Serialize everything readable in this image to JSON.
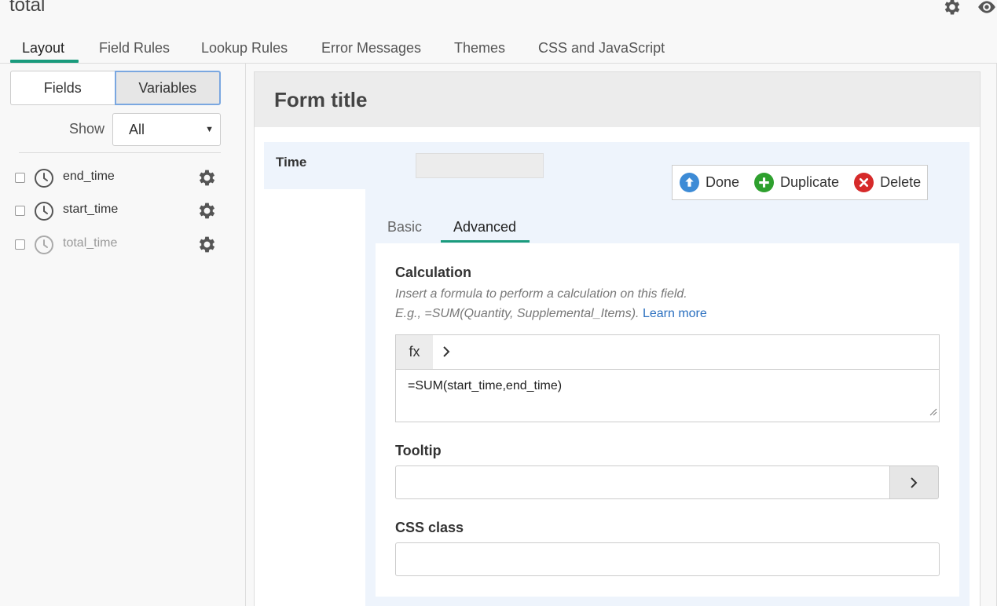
{
  "page": {
    "title": "total"
  },
  "header_icons": [
    "gear-icon",
    "eye-icon"
  ],
  "main_tabs": [
    {
      "label": "Layout",
      "active": true
    },
    {
      "label": "Field Rules",
      "active": false
    },
    {
      "label": "Lookup Rules",
      "active": false
    },
    {
      "label": "Error Messages",
      "active": false
    },
    {
      "label": "Themes",
      "active": false
    },
    {
      "label": "CSS and JavaScript",
      "active": false
    }
  ],
  "left_panel": {
    "toggle": {
      "fields_label": "Fields",
      "variables_label": "Variables",
      "active": "Variables"
    },
    "show": {
      "label": "Show",
      "selected": "All"
    },
    "variables": [
      {
        "name": "end_time",
        "icon": "clock-icon",
        "disabled": false
      },
      {
        "name": "start_time",
        "icon": "clock-icon",
        "disabled": false
      },
      {
        "name": "total_time",
        "icon": "clock-icon",
        "disabled": true
      }
    ]
  },
  "form": {
    "title": "Form title",
    "field": {
      "label": "Time",
      "actions": {
        "done": "Done",
        "duplicate": "Duplicate",
        "delete": "Delete"
      },
      "sub_tabs": [
        {
          "label": "Basic",
          "active": false
        },
        {
          "label": "Advanced",
          "active": true
        }
      ],
      "advanced": {
        "calculation": {
          "label": "Calculation",
          "hint_line1": "Insert a formula to perform a calculation on this field.",
          "hint_line2": "E.g., =SUM(Quantity, Supplemental_Items).",
          "learn_more": "Learn more",
          "fx_label": "fx",
          "formula": "=SUM(start_time,end_time)"
        },
        "tooltip": {
          "label": "Tooltip",
          "value": ""
        },
        "css_class": {
          "label": "CSS class",
          "value": ""
        }
      }
    }
  },
  "colors": {
    "accent": "#1a9b7d",
    "link": "#2a6fbf",
    "done": "#3d8bd6",
    "duplicate": "#2ea02e",
    "delete": "#d62a2a"
  }
}
